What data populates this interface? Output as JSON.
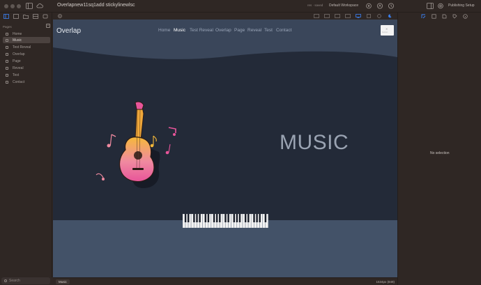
{
  "titlebar": {
    "document_title": "Overlapnew11sq1add stickylinewlsc",
    "small_status": "res · saved",
    "workspace": "Default Workspace",
    "publishing_setup": "Publishing Setup"
  },
  "sidebar": {
    "pages_heading": "Pages",
    "add_label": "+",
    "items": [
      {
        "label": "Home",
        "active": false
      },
      {
        "label": "Music",
        "active": true
      },
      {
        "label": "Test Reveal",
        "active": false
      },
      {
        "label": "Overlap",
        "active": false
      },
      {
        "label": "Page",
        "active": false
      },
      {
        "label": "Reveal",
        "active": false
      },
      {
        "label": "Test",
        "active": false
      },
      {
        "label": "Contact",
        "active": false
      }
    ],
    "search_placeholder": "Search"
  },
  "canvas": {
    "site_title": "Overlap",
    "nav": [
      {
        "label": "Home",
        "active": false
      },
      {
        "label": "Music",
        "active": true
      },
      {
        "label": "Test Reveal",
        "active": false
      },
      {
        "label": "Overlap",
        "active": false
      },
      {
        "label": "Page",
        "active": false
      },
      {
        "label": "Reveal",
        "active": false
      },
      {
        "label": "Test",
        "active": false
      },
      {
        "label": "Contact",
        "active": false
      }
    ],
    "header_button_icon": "✕",
    "header_button_label": "button",
    "hero_heading": "MUSIC",
    "colors": {
      "background": "#232a38",
      "header_band": "#3a465a",
      "bottom_band": "#435268",
      "heading_text": "#9aa3b2"
    }
  },
  "right_panel": {
    "empty_label": "No selection"
  },
  "statusbar": {
    "breadcrumb": "Music",
    "breakpoint": "1534px",
    "breakpoint_extra": "(849)"
  },
  "icons": [
    "sidebar-toggle-icon",
    "cloud-icon",
    "pages-icon",
    "layers-icon",
    "assets-icon",
    "undo-icon",
    "settings-icon",
    "desktop-icon",
    "tablet-icon",
    "phone-icon",
    "inspector-icon",
    "guitar-illustration",
    "piano-illustration",
    "search-icon"
  ]
}
